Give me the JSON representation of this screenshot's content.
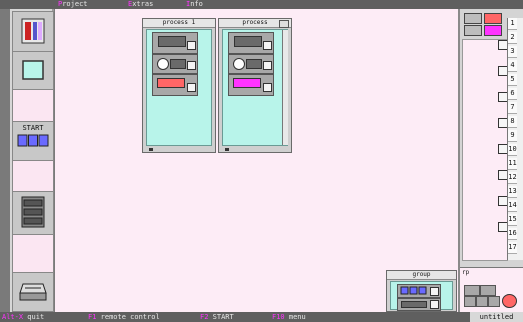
{
  "menu": {
    "items": [
      {
        "hotkey": "P",
        "rest": "roject"
      },
      {
        "hotkey": "E",
        "rest": "xtras"
      },
      {
        "hotkey": "I",
        "rest": "nfo"
      }
    ]
  },
  "statusbar": {
    "items": [
      {
        "key": "Alt-X",
        "label": "quit"
      },
      {
        "key": "F1",
        "label": "remote control"
      },
      {
        "key": "F2",
        "label": "START"
      },
      {
        "key": "F10",
        "label": "menu"
      }
    ],
    "filename": "untitled"
  },
  "left_toolbar": {
    "start_label": "START"
  },
  "windows": {
    "process1_title": "process 1",
    "process2_title": "process",
    "group_title": "group"
  },
  "right_panel": {
    "numbers": [
      "1",
      "2",
      "3",
      "4",
      "5",
      "6",
      "7",
      "8",
      "9",
      "10",
      "11",
      "12",
      "13",
      "14",
      "15",
      "16",
      "17"
    ],
    "bottom_label": "rp"
  },
  "colors": {
    "canvas": "#fdecf6",
    "window_body": "#b8f4ea",
    "accent_magenta": "#ff33ff",
    "accent_red": "#ff6666"
  }
}
